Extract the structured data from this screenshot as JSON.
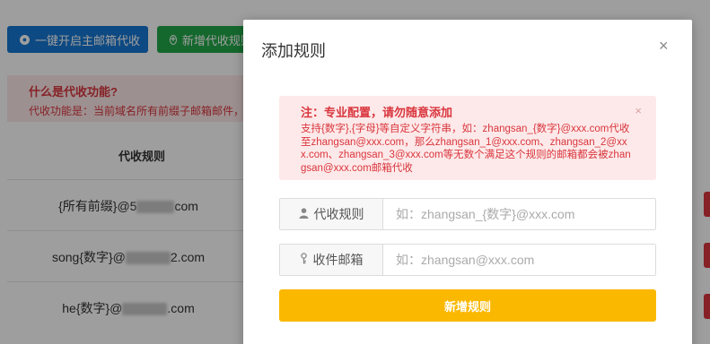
{
  "toolbar": {
    "enable_main_label": "一键开启主邮箱代收",
    "add_rule_label": "新增代收规则"
  },
  "notice": {
    "title": "什么是代收功能?",
    "text": "代收功能是：当前域名所有前缀子邮箱邮件，"
  },
  "table": {
    "header": "代收规则",
    "rows": [
      {
        "prefix": "{所有前缀}@5",
        "suffix": "com"
      },
      {
        "prefix": "song{数字}@",
        "suffix": "2.com"
      },
      {
        "prefix": "he{数字}@",
        "suffix": ".com"
      }
    ]
  },
  "modal": {
    "title": "添加规则",
    "close_icon": "×",
    "alert": {
      "title": "注：专业配置，请勿随意添加",
      "text": "支持{数字},{字母}等自定义字符串，如：zhangsan_{数字}@xxx.com代收至zhangsan@xxx.com，那么zhangsan_1@xxx.com、zhangsan_2@xxx.com、zhangsan_3@xxx.com等无数个满足这个规则的邮箱都会被zhangsan@xxx.com邮箱代收",
      "close_icon": "×"
    },
    "rule_field": {
      "label": "代收规则",
      "placeholder": "如：zhangsan_{数字}@xxx.com",
      "value": ""
    },
    "mailbox_field": {
      "label": "收件邮箱",
      "placeholder": "如：zhangsan@xxx.com",
      "value": ""
    },
    "submit_label": "新增规则"
  },
  "colors": {
    "primary_blue": "#1677d2",
    "success_green": "#22a94a",
    "warning_yellow": "#fbb800",
    "danger_red": "#d9363e",
    "alert_bg": "#fde9e9"
  }
}
